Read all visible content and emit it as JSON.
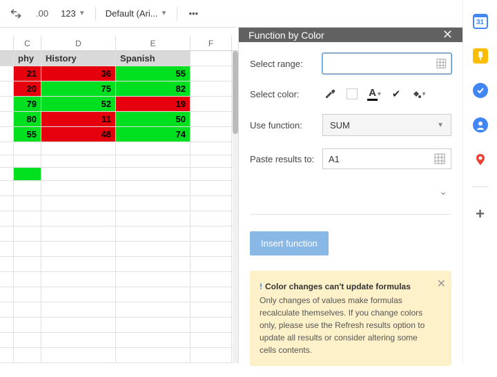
{
  "toolbar": {
    "decimal": ".00",
    "number_format": "123",
    "font": "Default (Ari...",
    "more": "•••"
  },
  "columns": [
    "C",
    "D",
    "E",
    "F"
  ],
  "headers": {
    "c": "phy",
    "d": "History",
    "e": "Spanish"
  },
  "rows": [
    {
      "c": {
        "v": "21",
        "c": "red"
      },
      "d": {
        "v": "36",
        "c": "red"
      },
      "e": {
        "v": "55",
        "c": "green"
      }
    },
    {
      "c": {
        "v": "20",
        "c": "red"
      },
      "d": {
        "v": "75",
        "c": "green"
      },
      "e": {
        "v": "82",
        "c": "green"
      }
    },
    {
      "c": {
        "v": "79",
        "c": "green"
      },
      "d": {
        "v": "52",
        "c": "green"
      },
      "e": {
        "v": "19",
        "c": "red"
      }
    },
    {
      "c": {
        "v": "80",
        "c": "green"
      },
      "d": {
        "v": "11",
        "c": "red"
      },
      "e": {
        "v": "50",
        "c": "green"
      }
    },
    {
      "c": {
        "v": "55",
        "c": "green"
      },
      "d": {
        "v": "48",
        "c": "red"
      },
      "e": {
        "v": "74",
        "c": "green"
      }
    }
  ],
  "sidebar": {
    "title": "Function by Color",
    "range_label": "Select range:",
    "color_label": "Select color:",
    "func_label": "Use function:",
    "func_value": "SUM",
    "paste_label": "Paste results to:",
    "paste_value": "A1",
    "insert_btn": "Insert function",
    "info_title": "Color changes can't update formulas",
    "info_body": "Only changes of values make formulas recalculate themselves. If you change colors only, please use the Refresh results option to update all results or consider altering some cells contents."
  },
  "rail": {
    "cal": "31"
  }
}
